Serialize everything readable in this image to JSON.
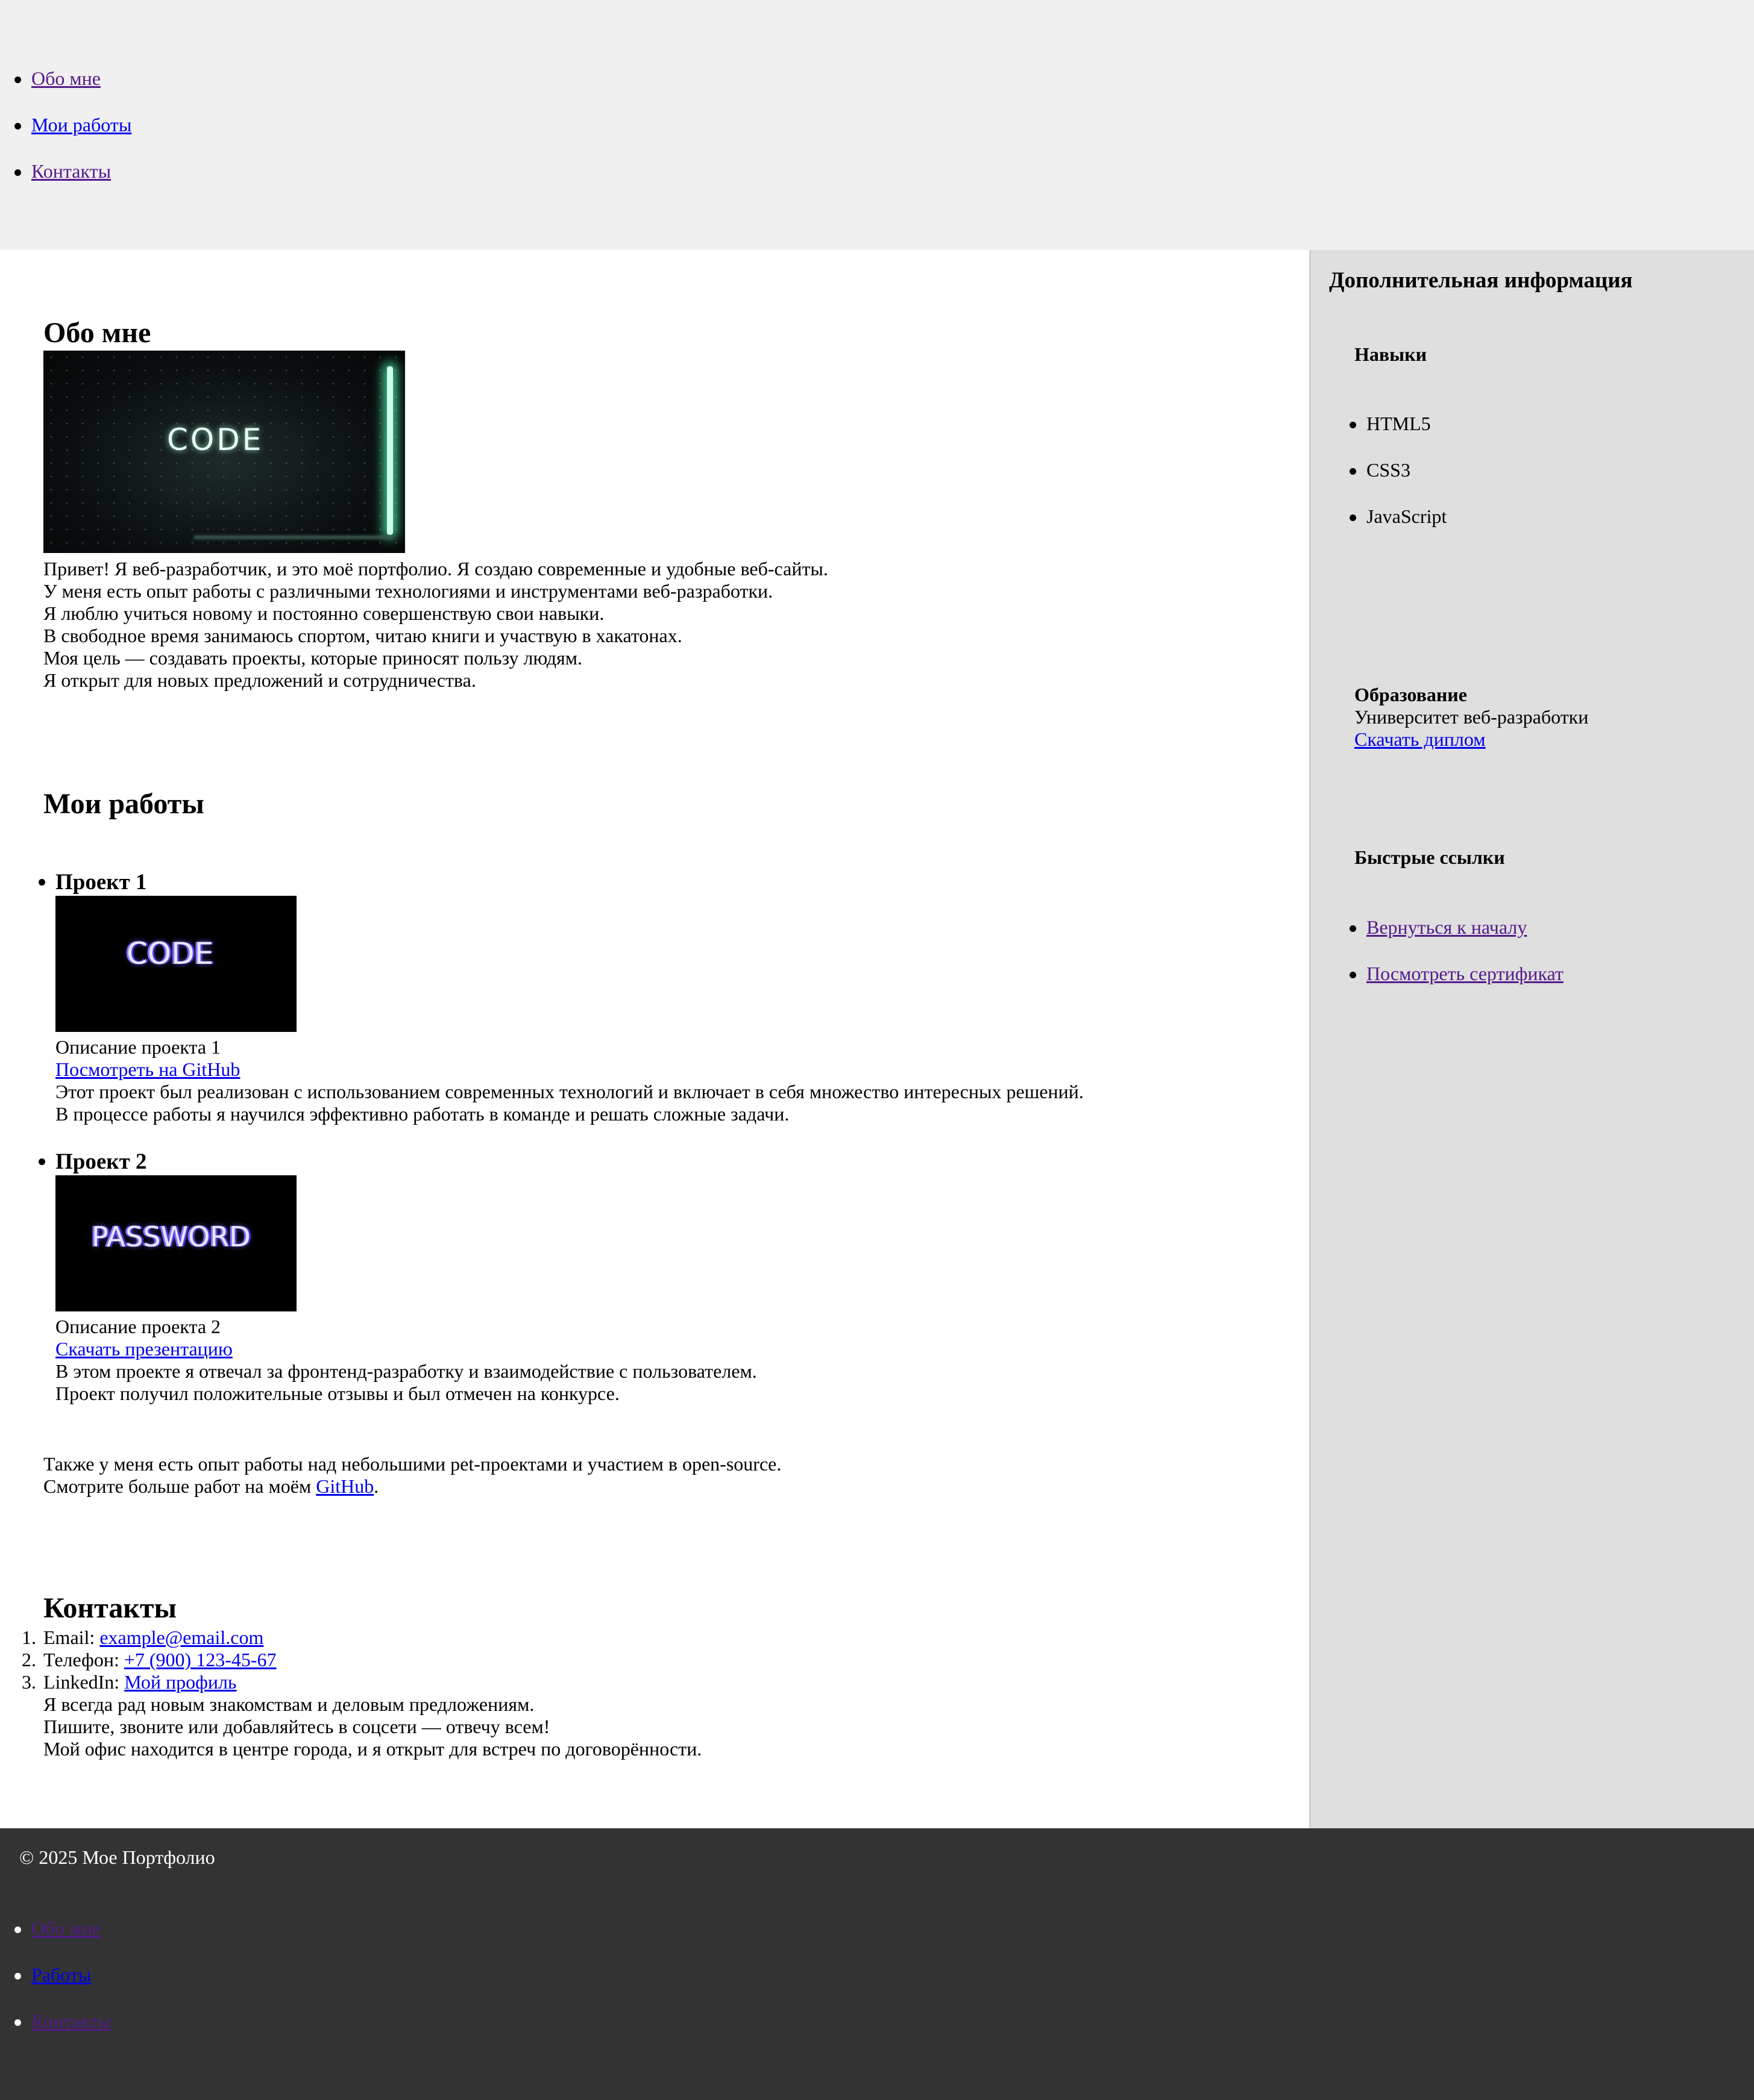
{
  "nav": {
    "items": [
      {
        "label": "Обо мне"
      },
      {
        "label": "Мои работы"
      },
      {
        "label": "Контакты"
      }
    ]
  },
  "about": {
    "title": "Обо мне",
    "image_text": "CODE",
    "paragraphs": [
      "Привет! Я веб-разработчик, и это моё портфолио. Я создаю современные и удобные веб-сайты.",
      "У меня есть опыт работы с различными технологиями и инструментами веб-разработки.",
      "Я люблю учиться новому и постоянно совершенствую свои навыки.",
      "В свободное время занимаюсь спортом, читаю книги и участвую в хакатонах.",
      "Моя цель — создавать проекты, которые приносят пользу людям.",
      "Я открыт для новых предложений и сотрудничества."
    ]
  },
  "works": {
    "title": "Мои работы",
    "projects": [
      {
        "title": "Проект 1",
        "image_text": "CODE",
        "description": "Описание проекта 1",
        "link": "Посмотреть на GitHub",
        "details": [
          "Этот проект был реализован с использованием современных технологий и включает в себя множество интересных решений.",
          "В процессе работы я научился эффективно работать в команде и решать сложные задачи."
        ]
      },
      {
        "title": "Проект 2",
        "image_text": "PASSWORD",
        "description": "Описание проекта 2",
        "link": "Скачать презентацию",
        "details": [
          "В этом проекте я отвечал за фронтенд-разработку и взаимодействие с пользователем.",
          "Проект получил положительные отзывы и был отмечен на конкурсе."
        ]
      }
    ],
    "extra_line": "Также у меня есть опыт работы над небольшими pet-проектами и участием в open-source.",
    "more_prefix": "Смотрите больше работ на моём ",
    "more_link": "GitHub",
    "more_suffix": "."
  },
  "contacts": {
    "title": "Контакты",
    "items": [
      {
        "label": "Email: ",
        "link": "example@email.com"
      },
      {
        "label": "Телефон: ",
        "link": "+7 (900) 123-45-67"
      },
      {
        "label": "LinkedIn: ",
        "link": "Мой профиль"
      }
    ],
    "notes": [
      "Я всегда рад новым знакомствам и деловым предложениям.",
      "Пишите, звоните или добавляйтесь в соцсети — отвечу всем!",
      "Мой офис находится в центре города, и я открыт для встреч по договорённости."
    ]
  },
  "sidebar": {
    "title": "Дополнительная информация",
    "skills": {
      "title": "Навыки",
      "items": [
        "HTML5",
        "CSS3",
        "JavaScript"
      ]
    },
    "education": {
      "title": "Образование",
      "school": "Университет веб-разработки",
      "link": "Скачать диплом"
    },
    "quick_links": {
      "title": "Быстрые ссылки",
      "items": [
        "Вернуться к началу",
        "Посмотреть сертификат"
      ]
    }
  },
  "footer": {
    "copyright": "© 2025 Мое Портфолио",
    "items": [
      "Обо мне",
      "Работы",
      "Контакты"
    ]
  },
  "colors": {
    "header_bg": "#f0f0f0",
    "aside_bg": "#dfdfdf",
    "footer_bg": "#333333",
    "link": "#0000ee",
    "visited": "#551a8b"
  }
}
